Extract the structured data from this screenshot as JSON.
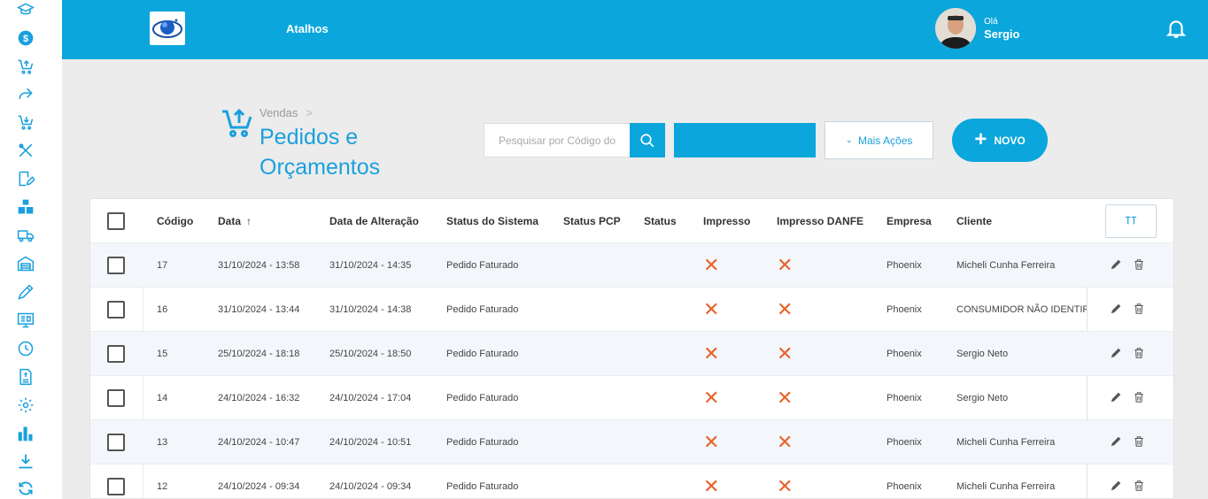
{
  "topbar": {
    "shortcuts_label": "Atalhos",
    "greeting": "Olá",
    "user_name": "Sergio"
  },
  "sidebar": {
    "items": [
      "graduation-cap-icon",
      "dollar-icon",
      "cart-up-icon",
      "share-icon",
      "cart-down-icon",
      "tools-icon",
      "edit-note-icon",
      "boxes-icon",
      "truck-icon",
      "warehouse-icon",
      "pencil-icon",
      "monitor-icon",
      "clock-icon",
      "invoice-icon",
      "gear-icon",
      "bar-chart-icon",
      "download-icon",
      "sync-icon"
    ]
  },
  "breadcrumb": {
    "parent": "Vendas",
    "separator": ">"
  },
  "page": {
    "title": "Pedidos e Orçamentos"
  },
  "search": {
    "placeholder": "Pesquisar por Código do"
  },
  "actions": {
    "more_label": "Mais Ações",
    "new_label": "NOVO"
  },
  "table": {
    "columns": [
      "Código",
      "Data",
      "Data de Alteração",
      "Status do Sistema",
      "Status PCP",
      "Status",
      "Impresso",
      "Impresso DANFE",
      "Empresa",
      "Cliente"
    ],
    "sort_indicator": "↑",
    "rows": [
      {
        "codigo": "17",
        "data": "31/10/2024 - 13:58",
        "alteracao": "31/10/2024 - 14:35",
        "status_sistema": "Pedido Faturado",
        "status_pcp": "",
        "status": "",
        "impresso": "✕",
        "impresso_danfe": "✕",
        "empresa": "Phoenix",
        "cliente": "Micheli Cunha Ferreira"
      },
      {
        "codigo": "16",
        "data": "31/10/2024 - 13:44",
        "alteracao": "31/10/2024 - 14:38",
        "status_sistema": "Pedido Faturado",
        "status_pcp": "",
        "status": "",
        "impresso": "✕",
        "impresso_danfe": "✕",
        "empresa": "Phoenix",
        "cliente": "CONSUMIDOR NÃO IDENTIFI"
      },
      {
        "codigo": "15",
        "data": "25/10/2024 - 18:18",
        "alteracao": "25/10/2024 - 18:50",
        "status_sistema": "Pedido Faturado",
        "status_pcp": "",
        "status": "",
        "impresso": "✕",
        "impresso_danfe": "✕",
        "empresa": "Phoenix",
        "cliente": "Sergio Neto"
      },
      {
        "codigo": "14",
        "data": "24/10/2024 - 16:32",
        "alteracao": "24/10/2024 - 17:04",
        "status_sistema": "Pedido Faturado",
        "status_pcp": "",
        "status": "",
        "impresso": "✕",
        "impresso_danfe": "✕",
        "empresa": "Phoenix",
        "cliente": "Sergio Neto"
      },
      {
        "codigo": "13",
        "data": "24/10/2024 - 10:47",
        "alteracao": "24/10/2024 - 10:51",
        "status_sistema": "Pedido Faturado",
        "status_pcp": "",
        "status": "",
        "impresso": "✕",
        "impresso_danfe": "✕",
        "empresa": "Phoenix",
        "cliente": "Micheli Cunha Ferreira"
      },
      {
        "codigo": "12",
        "data": "24/10/2024 - 09:34",
        "alteracao": "24/10/2024 - 09:34",
        "status_sistema": "Pedido Faturado",
        "status_pcp": "",
        "status": "",
        "impresso": "✕",
        "impresso_danfe": "✕",
        "empresa": "Phoenix",
        "cliente": "Micheli Cunha Ferreira"
      }
    ]
  },
  "colors": {
    "primary": "#0ba6dc",
    "accent_text": "#1aa0dd",
    "x_mark": "#e8642a",
    "background": "#ececec"
  }
}
